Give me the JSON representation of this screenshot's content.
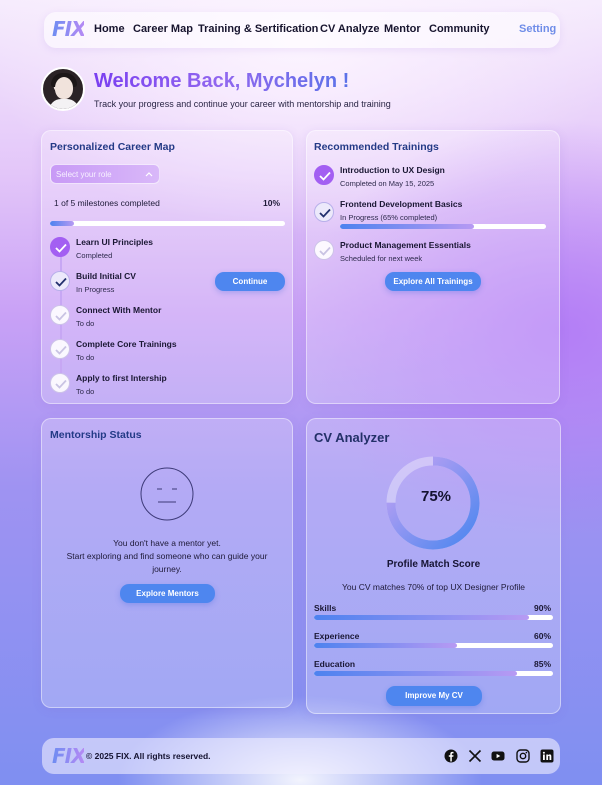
{
  "nav": {
    "logo": "FIX",
    "items": [
      "Home",
      "Career Map",
      "Training & Sertification",
      "CV Analyze",
      "Mentor",
      "Community"
    ],
    "setting": "Setting"
  },
  "welcome": {
    "title": "Welcome Back, Mychelyn !",
    "subtitle": "Track your progress and continue your career with mentorship and training"
  },
  "career_map": {
    "title": "Personalized Career Map",
    "select_placeholder": "Select your role",
    "milestones_text": "1 of 5 milestones completed",
    "progress_label": "10%",
    "progress_value": 0.1,
    "continue_label": "Continue",
    "steps": [
      {
        "label": "Learn UI Principles",
        "status": "Completed",
        "state": "done"
      },
      {
        "label": "Build Initial CV",
        "status": "In Progress",
        "state": "progress"
      },
      {
        "label": "Connect With Mentor",
        "status": "To do",
        "state": "todo"
      },
      {
        "label": "Complete Core Trainings",
        "status": "To do",
        "state": "todo"
      },
      {
        "label": "Apply to first Intership",
        "status": "To do",
        "state": "todo"
      }
    ]
  },
  "trainings": {
    "title": "Recommended Trainings",
    "items": [
      {
        "label": "Introduction to UX Design",
        "status": "Completed on May 15, 2025",
        "state": "done"
      },
      {
        "label": "Frontend Development Basics",
        "status": "In Progress (65% completed)",
        "state": "progress",
        "progress": 0.65
      },
      {
        "label": "Product Management Essentials",
        "status": "Scheduled for next week",
        "state": "todo"
      }
    ],
    "button": "Explore All Trainings"
  },
  "mentorship": {
    "title": "Mentorship Status",
    "line1": "You don't have a mentor yet.",
    "line2": "Start exploring and find someone who can guide your",
    "line3": "journey.",
    "button": "Explore Mentors"
  },
  "cv": {
    "title": "CV Analyzer",
    "score_label": "75%",
    "score": 0.75,
    "score_title": "Profile Match Score",
    "match_text": "You CV matches 70% of top UX Designer Profile",
    "metrics": [
      {
        "label": "Skills",
        "value_label": "90%",
        "value": 0.9
      },
      {
        "label": "Experience",
        "value_label": "60%",
        "value": 0.6
      },
      {
        "label": "Education",
        "value_label": "85%",
        "value": 0.85
      }
    ],
    "button": "Improve My CV"
  },
  "footer": {
    "logo": "FIX",
    "copyright": "© 2025 FIX. All rights reserved.",
    "social_icons": [
      "facebook-icon",
      "x-icon",
      "youtube-icon",
      "instagram-icon",
      "linkedin-icon"
    ]
  },
  "colors": {
    "accent_blue": "#4e86ef",
    "accent_purple": "#a35ff2",
    "title_blue": "#233a86"
  }
}
